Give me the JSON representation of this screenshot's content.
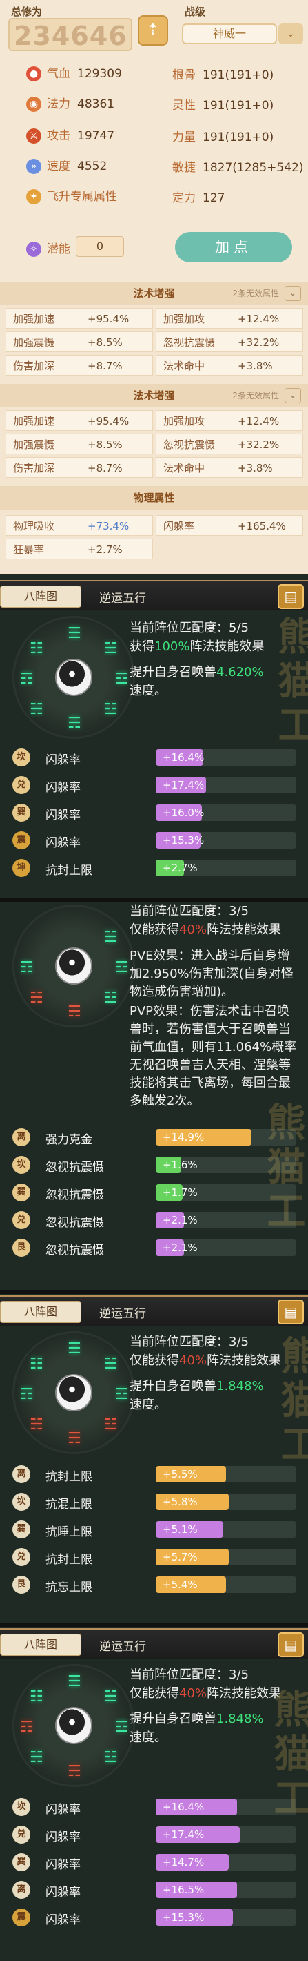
{
  "header": {
    "total_label": "总修为",
    "total_value": "234646",
    "grade_label": "战级",
    "grade_value": "神威一",
    "up_icon": "arrow-up-icon",
    "grade_arrow": "⌄"
  },
  "stats": [
    {
      "icon": "blood-icon",
      "label": "气血",
      "value": "129309",
      "label2": "根骨",
      "value2": "191(191+0)"
    },
    {
      "icon": "mana-icon",
      "label": "法力",
      "value": "48361",
      "label2": "灵性",
      "value2": "191(191+0)"
    },
    {
      "icon": "attack-icon",
      "label": "攻击",
      "value": "19747",
      "label2": "力量",
      "value2": "191(191+0)"
    },
    {
      "icon": "speed-icon",
      "label": "速度",
      "value": "4552",
      "label2": "敏捷",
      "value2": "1827(1285+542)"
    },
    {
      "icon": "fly-icon",
      "label": "飞升专属属性",
      "value": "",
      "label2": "定力",
      "value2": "127"
    }
  ],
  "potential": {
    "label": "潜能",
    "value": "0"
  },
  "add_button": "加点",
  "tables": [
    {
      "title": "法术增强",
      "note": "2条无效属性",
      "rows": [
        [
          "加强加速",
          "+95.4%",
          "加强加攻",
          "+12.4%"
        ],
        [
          "加强震慑",
          "+8.5%",
          "忽视抗震慑",
          "+32.2%"
        ],
        [
          "伤害加深",
          "+8.7%",
          "法术命中",
          "+3.8%"
        ]
      ]
    },
    {
      "title": "法术增强",
      "note": "2条无效属性",
      "rows": [
        [
          "加强加速",
          "+95.4%",
          "加强加攻",
          "+12.4%"
        ],
        [
          "加强震慑",
          "+8.5%",
          "忽视抗震慑",
          "+32.2%"
        ],
        [
          "伤害加深",
          "+8.7%",
          "法术命中",
          "+3.8%"
        ]
      ]
    },
    {
      "title": "物理属性",
      "note": "",
      "rows": [
        [
          "物理吸收",
          "+73.4%",
          "闪躲率",
          "+165.4%"
        ],
        [
          "狂暴率",
          "+2.7%",
          "",
          ""
        ]
      ]
    }
  ],
  "formations": [
    {
      "tab": "八阵图",
      "title": "逆运五行",
      "line1": "当前阵位匹配度：5/5",
      "line2a": "获得",
      "line2b": "100%",
      "line2c": "阵法技能效果",
      "line3a": "提升自身召唤兽",
      "line3b": "4.620%",
      "line3c": "速度。",
      "rows": [
        {
          "tag": "坎",
          "label": "闪躲率",
          "value": "+16.4%",
          "pct": 0.34,
          "color": "purple"
        },
        {
          "tag": "兑",
          "label": "闪躲率",
          "value": "+17.4%",
          "pct": 0.36,
          "color": "purple"
        },
        {
          "tag": "巽",
          "label": "闪躲率",
          "value": "+16.0%",
          "pct": 0.33,
          "color": "purple"
        },
        {
          "tag": "震",
          "label": "闪躲率",
          "value": "+15.3%",
          "pct": 0.32,
          "color": "purple"
        },
        {
          "tag": "坤",
          "label": "抗封上限",
          "value": "+2.7%",
          "pct": 0.2,
          "color": "green"
        }
      ]
    },
    {
      "tab": "",
      "title": "",
      "line1": "当前阵位匹配度：3/5",
      "line2a": "仅能获得",
      "line2b": "40%",
      "line2c": "阵法技能效果",
      "pve": "PVE效果：进入战斗后自身增加2.950%伤害加深(自身对怪物造成伤害增加)。",
      "pvp": "PVP效果：伤害法术击中召唤兽时，若伤害值大于召唤兽当前气血值，则有11.064%概率无视召唤兽吉人天相、涅槃等技能将其击飞离场，每回合最多触发2次。",
      "rows": [
        {
          "tag": "离",
          "label": "强力克金",
          "value": "+14.9%",
          "pct": 0.68,
          "color": "orange"
        },
        {
          "tag": "坎",
          "label": "忽视抗震慑",
          "value": "+1.6%",
          "pct": 0.18,
          "color": "green"
        },
        {
          "tag": "巽",
          "label": "忽视抗震慑",
          "value": "+1.7%",
          "pct": 0.19,
          "color": "green"
        },
        {
          "tag": "兑",
          "label": "忽视抗震慑",
          "value": "+2.1%",
          "pct": 0.2,
          "color": "purple"
        },
        {
          "tag": "艮",
          "label": "忽视抗震慑",
          "value": "+2.1%",
          "pct": 0.2,
          "color": "purple"
        }
      ]
    },
    {
      "tab": "八阵图",
      "title": "逆运五行",
      "line1": "当前阵位匹配度：3/5",
      "line2a": "仅能获得",
      "line2b": "40%",
      "line2c": "阵法技能效果",
      "line3a": "提升自身召唤兽",
      "line3b": "1.848%",
      "line3c": "速度。",
      "rows": [
        {
          "tag": "离",
          "label": "抗封上限",
          "value": "+5.5%",
          "pct": 0.5,
          "color": "orange"
        },
        {
          "tag": "坎",
          "label": "抗混上限",
          "value": "+5.8%",
          "pct": 0.52,
          "color": "orange"
        },
        {
          "tag": "巽",
          "label": "抗睡上限",
          "value": "+5.1%",
          "pct": 0.48,
          "color": "purple"
        },
        {
          "tag": "兑",
          "label": "抗封上限",
          "value": "+5.7%",
          "pct": 0.52,
          "color": "orange"
        },
        {
          "tag": "艮",
          "label": "抗忘上限",
          "value": "+5.4%",
          "pct": 0.5,
          "color": "orange"
        }
      ]
    },
    {
      "tab": "八阵图",
      "title": "逆运五行",
      "line1": "当前阵位匹配度：3/5",
      "line2a": "仅能获得",
      "line2b": "40%",
      "line2c": "阵法技能效果",
      "line3a": "提升自身召唤兽",
      "line3b": "1.848%",
      "line3c": "速度。",
      "rows": [
        {
          "tag": "坎",
          "label": "闪躲率",
          "value": "+16.4%",
          "pct": 0.58,
          "color": "purple"
        },
        {
          "tag": "兑",
          "label": "闪躲率",
          "value": "+17.4%",
          "pct": 0.6,
          "color": "purple"
        },
        {
          "tag": "巽",
          "label": "闪躲率",
          "value": "+14.7%",
          "pct": 0.52,
          "color": "purple"
        },
        {
          "tag": "离",
          "label": "闪躲率",
          "value": "+16.5%",
          "pct": 0.58,
          "color": "purple"
        },
        {
          "tag": "震",
          "label": "闪躲率",
          "value": "+15.3%",
          "pct": 0.55,
          "color": "purple"
        }
      ]
    }
  ],
  "corner_icon": "book-icon",
  "colors": {
    "purple": "#c67ee0",
    "green": "#66d45e",
    "orange": "#f0b24a",
    "highlight_green": "#3de07a",
    "highlight_red": "#e04a3a"
  }
}
